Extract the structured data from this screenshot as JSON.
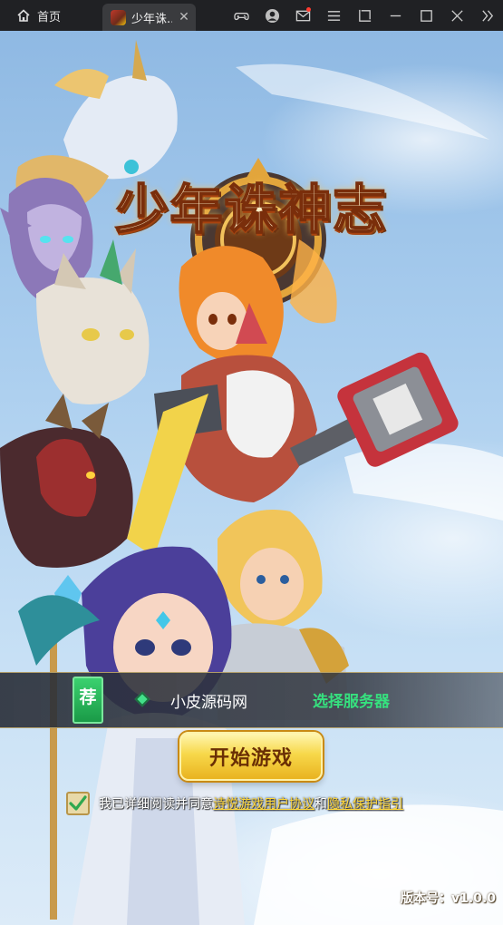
{
  "titlebar": {
    "home_tab_label": "首页",
    "game_tab_label": "少年诛...",
    "tab_close_glyph": "✕",
    "icons": [
      "gamepad-icon",
      "account-icon",
      "mail-icon",
      "menu-icon",
      "screenshot-icon",
      "minimize-icon",
      "maximize-icon",
      "close-icon",
      "collapse-icon"
    ]
  },
  "game": {
    "logo_title": "少年诛神志",
    "server": {
      "badge": "荐",
      "name": "小皮源码网",
      "select_label": "选择服务器"
    },
    "start_button": "开始游戏",
    "agreement": {
      "checked": true,
      "prefix": "我已详细阅读并同意",
      "link1": "诗悦游戏用户协议",
      "joiner": "和",
      "link2": "隐私保护指引"
    },
    "version": "版本号：v1.0.0"
  },
  "colors": {
    "titlebar_bg": "#202124",
    "server_select": "#36e07e",
    "badge_green": "#1a9a47",
    "start_gold": "#f7d84a",
    "agreement_link": "#ffd83d"
  }
}
